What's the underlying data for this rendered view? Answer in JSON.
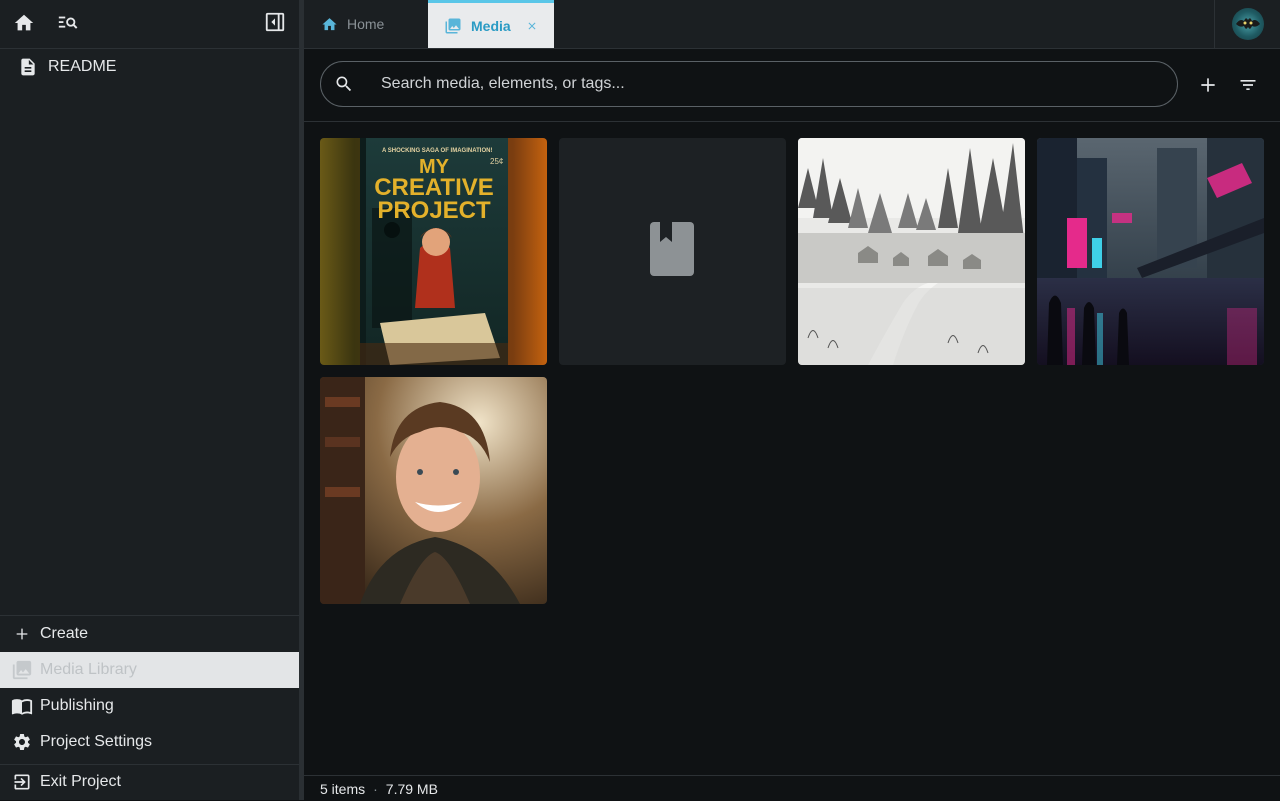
{
  "sidebar": {
    "tree": [
      {
        "label": "README",
        "icon": "document-icon"
      }
    ],
    "bottom_items": [
      {
        "label": "Create",
        "icon": "plus-icon"
      },
      {
        "label": "Media Library",
        "icon": "media-library-icon",
        "active": true
      },
      {
        "label": "Publishing",
        "icon": "book-icon"
      },
      {
        "label": "Project Settings",
        "icon": "gear-icon"
      },
      {
        "label": "Exit Project",
        "icon": "exit-icon"
      }
    ]
  },
  "tabs": [
    {
      "label": "Home",
      "icon": "home-icon",
      "active": false
    },
    {
      "label": "Media",
      "icon": "media-library-icon",
      "active": true
    }
  ],
  "search": {
    "placeholder": "Search media, elements, or tags..."
  },
  "media_items": [
    {
      "type": "image",
      "cover_lines": [
        "A SHOCKING SAGA OF IMAGINATION!",
        "MY",
        "CREATIVE",
        "PROJECT",
        "25¢"
      ]
    },
    {
      "type": "book-placeholder",
      "icon": "book-icon"
    },
    {
      "type": "image"
    },
    {
      "type": "image"
    },
    {
      "type": "image"
    }
  ],
  "status": {
    "count": "5 items",
    "separator": "·",
    "size": "7.79 MB"
  },
  "colors": {
    "accent": "#59c6e8",
    "sidebar_bg": "#1b1f22",
    "main_bg": "#0f1214"
  }
}
